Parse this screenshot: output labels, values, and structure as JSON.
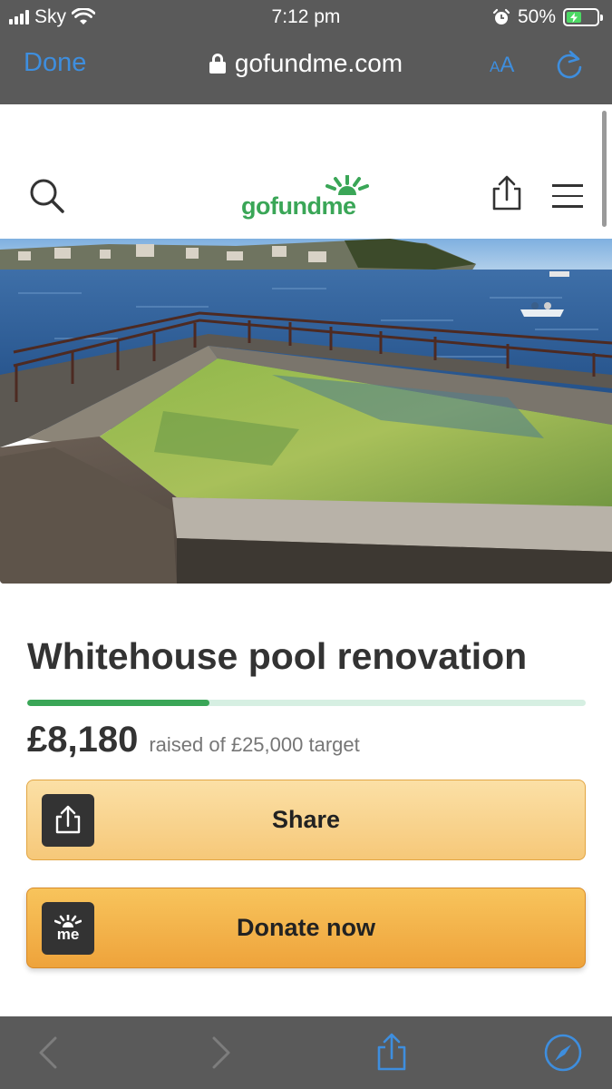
{
  "status_bar": {
    "carrier": "Sky",
    "time": "7:12 pm",
    "battery": "50%",
    "battery_level": 0.5
  },
  "browser": {
    "done_label": "Done",
    "url": "gofundme.com",
    "aa_small": "A",
    "aa_large": "A"
  },
  "site": {
    "logo_text": "gofundme"
  },
  "campaign": {
    "title": "Whitehouse pool renovation",
    "raised": "£8,180",
    "raised_sub": "raised of £25,000 target",
    "progress": 0.327
  },
  "buttons": {
    "share_label": "Share",
    "donate_label": "Donate now",
    "donate_icon_text": "me"
  },
  "colors": {
    "brand_green": "#3aa657",
    "ios_blue": "#3e8ede",
    "share_btn": "#f6c879",
    "donate_btn": "#eea33b"
  },
  "icons": [
    "signal-icon",
    "wifi-icon",
    "alarm-icon",
    "battery-icon",
    "lock-icon",
    "reload-icon",
    "search-icon",
    "share-icon",
    "menu-icon",
    "back-icon",
    "forward-icon",
    "compass-icon"
  ]
}
